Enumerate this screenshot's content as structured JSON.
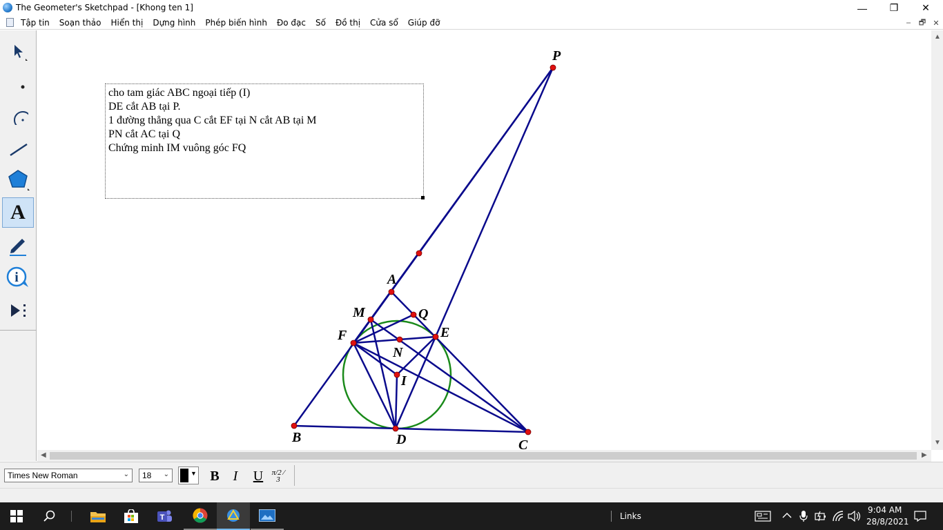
{
  "window": {
    "title": "The Geometer's Sketchpad - [Khong ten 1]",
    "controls": {
      "minimize": "—",
      "maximize": "❐",
      "close": "✕"
    }
  },
  "menu": {
    "items": [
      "Tập tin",
      "Soạn thảo",
      "Hiển thị",
      "Dựng hình",
      "Phép biến hình",
      "Đo đạc",
      "Số",
      "Đồ thị",
      "Cửa sổ",
      "Giúp đỡ"
    ],
    "mdi_controls": {
      "minimize": "–",
      "restore": "🗗",
      "close": "✕"
    }
  },
  "toolbox": {
    "tools": [
      "arrow-tool",
      "point-tool",
      "compass-tool",
      "straightedge-tool",
      "polygon-tool",
      "text-tool",
      "marker-tool",
      "information-tool",
      "custom-tool"
    ],
    "selected": "text-tool",
    "text_tool_glyph": "A"
  },
  "caption": {
    "lines": [
      "cho tam giác ABC ngoại tiếp (I)",
      "DE cắt AB tại P.",
      "1 đường thẳng qua C cắt EF tại N cắt AB tại M",
      "PN cắt AC tại Q",
      "Chứng minh IM vuông góc FQ"
    ]
  },
  "sketch": {
    "colors": {
      "segment": "#0a0a8c",
      "circle": "#1a8a1a",
      "point": "#e01010"
    },
    "point_labels": [
      "P",
      "A",
      "M",
      "Q",
      "F",
      "E",
      "N",
      "I",
      "B",
      "D",
      "C"
    ]
  },
  "format_bar": {
    "font": "Times New Roman",
    "size": "18",
    "text_color": "#000000",
    "bold": "B",
    "italic": "I",
    "underline": "U",
    "math_format": "π/2 ⁄ 3"
  },
  "taskbar": {
    "apps": [
      "windows-start",
      "search",
      "file-explorer",
      "microsoft-store",
      "teams",
      "chrome",
      "geometers-sketchpad",
      "photos"
    ],
    "links_label": "Links",
    "time": "9:04 AM",
    "date": "28/8/2021"
  }
}
